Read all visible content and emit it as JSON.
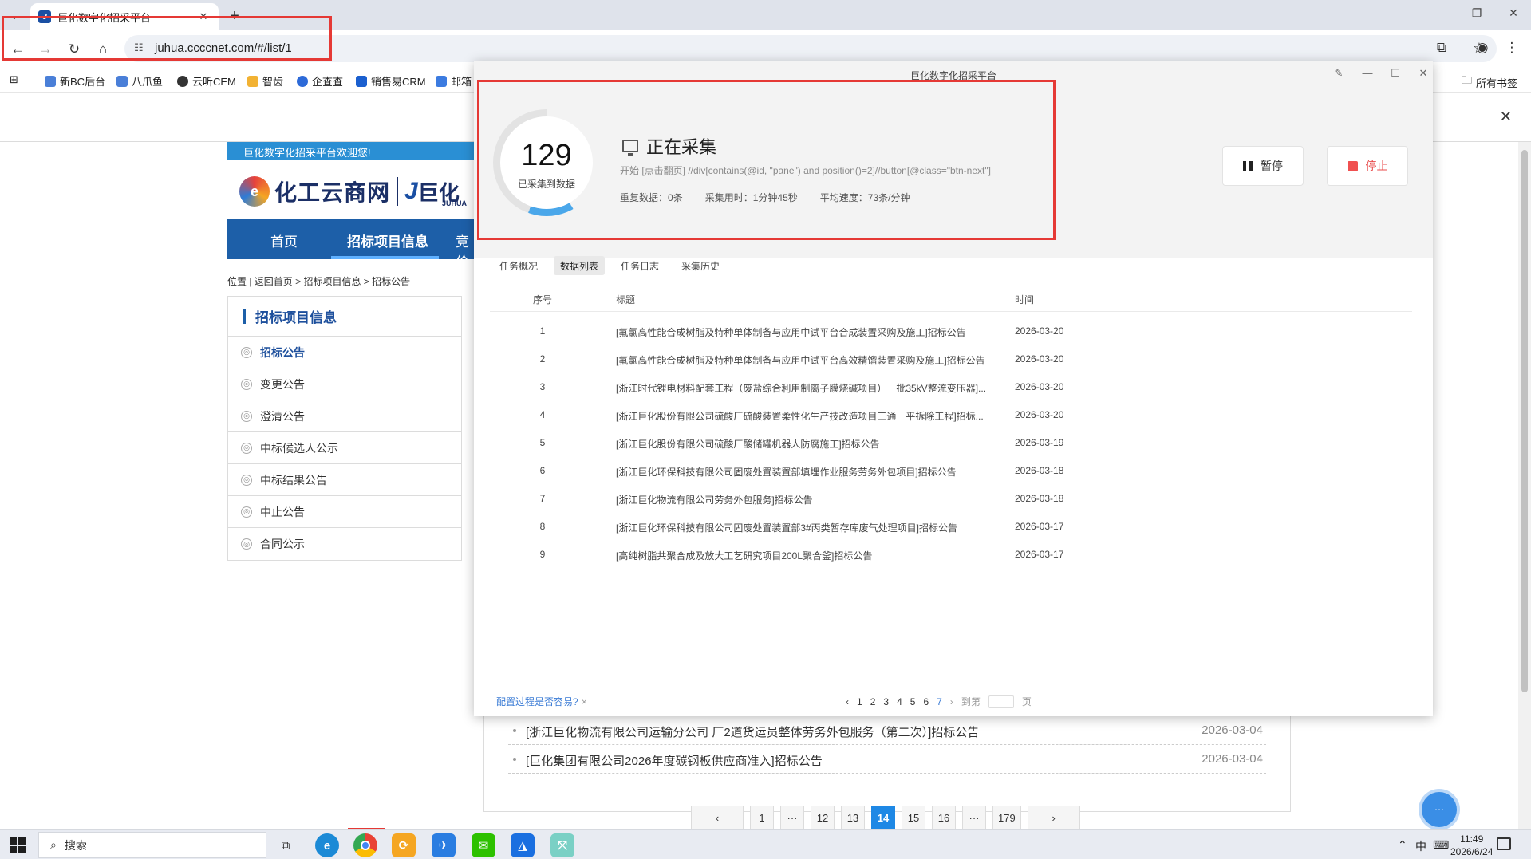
{
  "browser": {
    "tab_title": "巨化数字化招采平台",
    "tab_favicon": "J",
    "new_tab": "+",
    "url": "juhua.ccccnet.com/#/list/1",
    "bookmarks": [
      "新BC后台",
      "八爪鱼",
      "云听CEM",
      "智齿",
      "企查查",
      "销售易CRM",
      "邮箱"
    ],
    "all_bookmarks": "所有书签"
  },
  "site": {
    "welcome": "巨化数字化招采平台欢迎您!",
    "logo_text": "化工云商网",
    "logo_text2": "巨化",
    "logo_sub": "JUHUA",
    "nav": [
      "首页",
      "招标项目信息",
      "竞价"
    ],
    "breadcrumb": "位置 | 返回首页 > 招标项目信息 > 招标公告",
    "sidebar_title": "招标项目信息",
    "sidebar_items": [
      "招标公告",
      "变更公告",
      "澄清公告",
      "中标候选人公示",
      "中标结果公告",
      "中止公告",
      "合同公示"
    ],
    "list_rows": [
      {
        "title": "[浙江巨化物流有限公司运输分公司 厂2道货运员整体劳务外包服务（第二次）]招标公告",
        "date": "2026-03-04"
      },
      {
        "title": "[巨化集团有限公司2026年度碳钢板供应商准入]招标公告",
        "date": "2026-03-04"
      }
    ],
    "pager": [
      "1",
      "···",
      "12",
      "13",
      "14",
      "15",
      "16",
      "···",
      "179"
    ],
    "pager_active": "14",
    "pager_prev": "‹",
    "pager_next": "›"
  },
  "popup": {
    "title": "巨化数字化招采平台",
    "count": "129",
    "count_label": "已采集到数据",
    "status": "正在采集",
    "xpath": "开始 [点击翻页] //div[contains(@id, \"pane\") and position()=2]//button[@class=\"btn-next\"]",
    "dup_label": "重复数据：",
    "dup_value": "0条",
    "time_label": "采集用时：",
    "time_value": "1分钟45秒",
    "speed_label": "平均速度：",
    "speed_value": "73条/分钟",
    "pause": "暂停",
    "stop": "停止",
    "tabs": [
      "任务概况",
      "数据列表",
      "任务日志",
      "采集历史"
    ],
    "active_tab": "数据列表",
    "columns": [
      "序号",
      "标题",
      "时间"
    ],
    "rows": [
      {
        "idx": "1",
        "title": "[氟氯高性能合成树脂及特种单体制备与应用中试平台合成装置采购及施工]招标公告",
        "time": "2026-03-20"
      },
      {
        "idx": "2",
        "title": "[氟氯高性能合成树脂及特种单体制备与应用中试平台高效精馏装置采购及施工]招标公告",
        "time": "2026-03-20"
      },
      {
        "idx": "3",
        "title": "[浙江时代锂电材料配套工程（废盐综合利用制离子膜烧碱项目）一批35kV整流变压器]...",
        "time": "2026-03-20"
      },
      {
        "idx": "4",
        "title": "[浙江巨化股份有限公司硫酸厂硫酸装置柔性化生产技改造项目三通一平拆除工程]招标...",
        "time": "2026-03-20"
      },
      {
        "idx": "5",
        "title": "[浙江巨化股份有限公司硫酸厂酸储罐机器人防腐施工]招标公告",
        "time": "2026-03-19"
      },
      {
        "idx": "6",
        "title": "[浙江巨化环保科技有限公司固废处置装置部填埋作业服务劳务外包项目]招标公告",
        "time": "2026-03-18"
      },
      {
        "idx": "7",
        "title": "[浙江巨化物流有限公司劳务外包服务]招标公告",
        "time": "2026-03-18"
      },
      {
        "idx": "8",
        "title": "[浙江巨化环保科技有限公司固废处置装置部3#丙类暂存库废气处理项目]招标公告",
        "time": "2026-03-17"
      },
      {
        "idx": "9",
        "title": "[高纯树脂共聚合成及放大工艺研究项目200L聚合釜]招标公告",
        "time": "2026-03-17"
      }
    ],
    "footer_link": "配置过程是否容易?",
    "footer_close": "×",
    "pages": [
      "1",
      "2",
      "3",
      "4",
      "5",
      "6",
      "7"
    ],
    "current_page": "7",
    "goto_label": "到第",
    "page_unit": "页"
  },
  "taskbar": {
    "search": "搜索",
    "ime": "中",
    "time": "11:49",
    "date": "2026/6/24"
  },
  "colors": {
    "accent": "#1d5fa8",
    "highlight": "#e53935",
    "progress": "#4aa7ea",
    "stop": "#f05050"
  }
}
